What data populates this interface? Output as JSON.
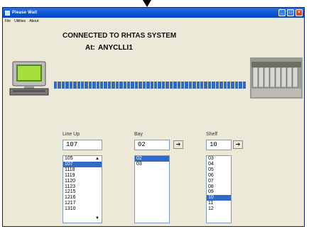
{
  "window": {
    "title": "Please Wait"
  },
  "menu": {
    "items": [
      "File",
      "Utilities",
      "About"
    ]
  },
  "status": {
    "heading": "CONNECTED TO RHTAS SYSTEM",
    "at_label": "At:",
    "at_value": "ANYCLLI1",
    "progress_segments": 50
  },
  "lineup": {
    "label": "Line Up",
    "value": "107",
    "items": [
      "105",
      "107",
      "1118",
      "1119",
      "1120",
      "1123",
      "1215",
      "1216",
      "1217",
      "1310"
    ],
    "selected": "107"
  },
  "bay": {
    "label": "Bay",
    "value": "02",
    "items": [
      "02",
      "03"
    ],
    "selected": "02"
  },
  "shelf": {
    "label": "Shelf",
    "value": "10",
    "items": [
      "03",
      "04",
      "05",
      "06",
      "07",
      "08",
      "09",
      "10",
      "11",
      "12"
    ],
    "selected": "10"
  },
  "icons": {
    "computer": "computer-terminal-icon",
    "equipment": "telecom-rack-icon"
  }
}
